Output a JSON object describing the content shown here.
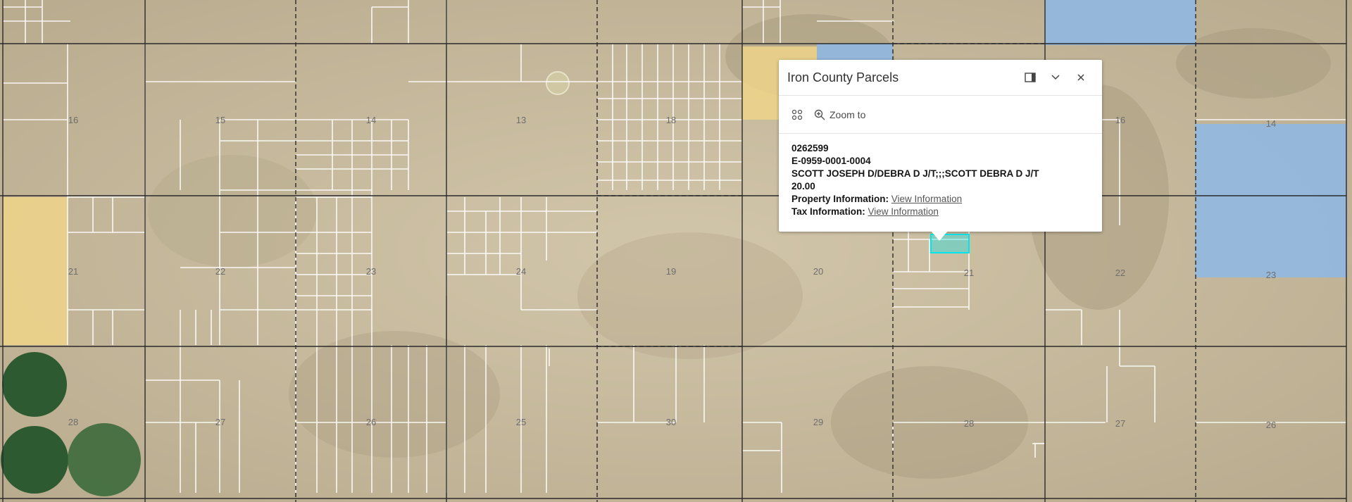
{
  "map": {
    "section_numbers": [
      {
        "label": "16"
      },
      {
        "label": "15"
      },
      {
        "label": "14"
      },
      {
        "label": "13"
      },
      {
        "label": "18"
      },
      {
        "label": "16"
      },
      {
        "label": "14"
      },
      {
        "label": "21"
      },
      {
        "label": "22"
      },
      {
        "label": "23"
      },
      {
        "label": "24"
      },
      {
        "label": "19"
      },
      {
        "label": "20"
      },
      {
        "label": "21"
      },
      {
        "label": "22"
      },
      {
        "label": "23"
      },
      {
        "label": "28"
      },
      {
        "label": "27"
      },
      {
        "label": "26"
      },
      {
        "label": "25"
      },
      {
        "label": "30"
      },
      {
        "label": "29"
      },
      {
        "label": "28"
      },
      {
        "label": "27"
      },
      {
        "label": "26"
      }
    ],
    "colors": {
      "terrain": "#c9bc9f",
      "parcel_line": "#ffffff",
      "section_line": "#2a2a2a",
      "highlight_yellow": "#eed58a",
      "highlight_blue": "#8db8e6",
      "selected_parcel": "#00e5ee",
      "field_green": "#2e5a32"
    }
  },
  "popup": {
    "title": "Iron County Parcels",
    "zoom_to_label": "Zoom to",
    "parcel_id": "0262599",
    "account": "E-0959-0001-0004",
    "owner": "SCOTT JOSEPH D/DEBRA D J/T;;;SCOTT DEBRA D J/T",
    "acreage": "20.00",
    "property_label": "Property Information:",
    "property_link": "View Information",
    "tax_label": "Tax Information:",
    "tax_link": "View Information"
  }
}
